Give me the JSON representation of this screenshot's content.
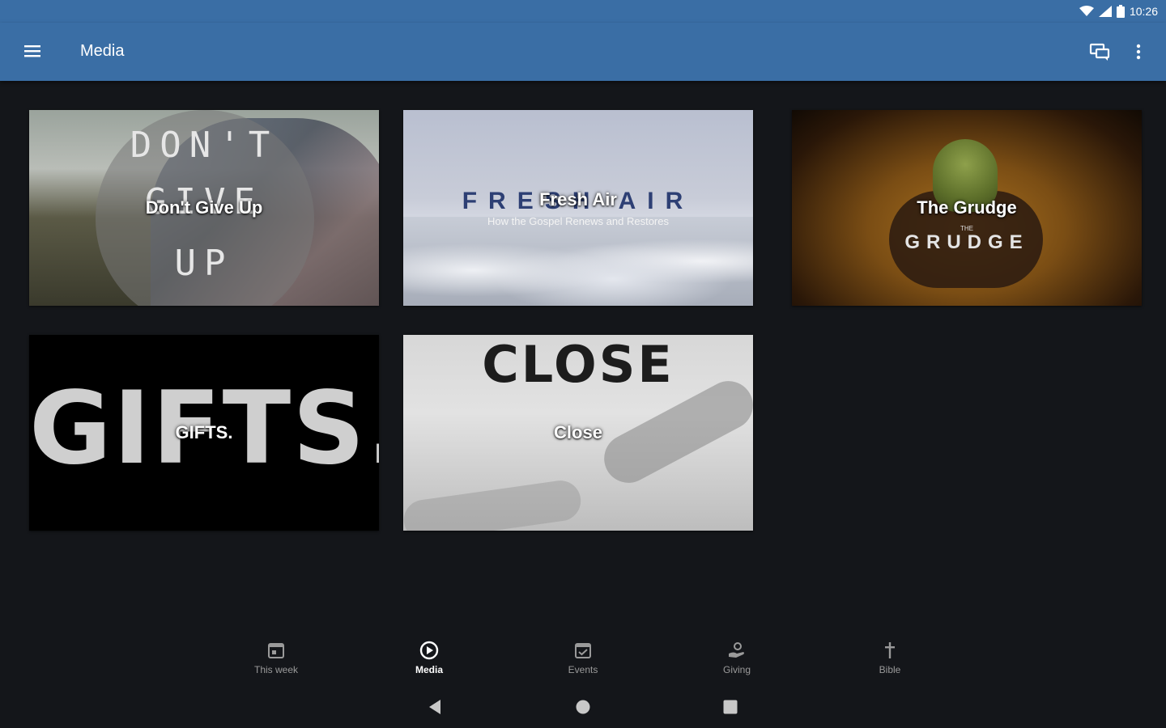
{
  "status_bar": {
    "time": "10:26"
  },
  "app_bar": {
    "title": "Media"
  },
  "cards": [
    {
      "caption": "Don't Give Up",
      "art_lines": [
        "DON'T",
        "GIVE",
        "UP"
      ]
    },
    {
      "caption": "Fresh Air",
      "art_title": "FRESH AIR",
      "art_subtitle": "How the Gospel Renews and Restores"
    },
    {
      "caption": "The Grudge",
      "art_small": "THE",
      "art_title": "GRUDGE"
    },
    {
      "caption": "GIFTS.",
      "art_title": "GIFTS."
    },
    {
      "caption": "Close",
      "art_title": "CLOSE"
    }
  ],
  "bottom_nav": [
    {
      "label": "This week",
      "icon": "calendar-icon",
      "active": false
    },
    {
      "label": "Media",
      "icon": "play-circle-icon",
      "active": true
    },
    {
      "label": "Events",
      "icon": "calendar-check-icon",
      "active": false
    },
    {
      "label": "Giving",
      "icon": "hand-heart-icon",
      "active": false
    },
    {
      "label": "Bible",
      "icon": "cross-icon",
      "active": false
    }
  ],
  "colors": {
    "app_bar": "#3a6ea5",
    "background": "#14161a"
  }
}
